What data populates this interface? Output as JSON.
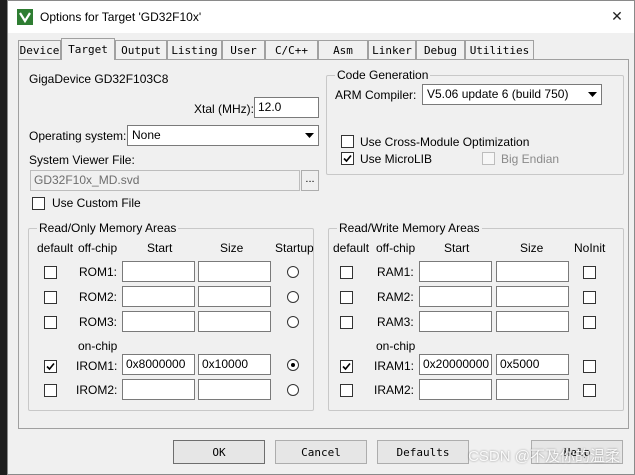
{
  "window": {
    "title": "Options for Target 'GD32F10x'",
    "close_glyph": "✕"
  },
  "tabs": [
    "Device",
    "Target",
    "Output",
    "Listing",
    "User",
    "C/C++",
    "Asm",
    "Linker",
    "Debug",
    "Utilities"
  ],
  "active_tab": "Target",
  "device": {
    "name": "GigaDevice GD32F103C8"
  },
  "xtal": {
    "label": "Xtal (MHz):",
    "value": "12.0"
  },
  "os": {
    "label": "Operating system:",
    "value": "None"
  },
  "sysviewer": {
    "label": "System Viewer File:",
    "value": "GD32F10x_MD.svd",
    "browse": "...",
    "custom_label": "Use Custom File",
    "custom_checked": false
  },
  "codegen": {
    "legend": "Code Generation",
    "compiler_label": "ARM Compiler:",
    "compiler_value": "V5.06 update 6 (build 750)",
    "cross_module_label": "Use Cross-Module Optimization",
    "cross_module_checked": false,
    "microlib_label": "Use MicroLIB",
    "microlib_checked": true,
    "big_endian_label": "Big Endian",
    "big_endian_checked": false
  },
  "rom": {
    "legend": "Read/Only Memory Areas",
    "headers": {
      "default": "default",
      "offchip": "off-chip",
      "start": "Start",
      "size": "Size",
      "startup": "Startup"
    },
    "onchip_label": "on-chip",
    "rows": [
      {
        "label": "ROM1:",
        "start": "",
        "size": "",
        "default": false,
        "startup": false
      },
      {
        "label": "ROM2:",
        "start": "",
        "size": "",
        "default": false,
        "startup": false
      },
      {
        "label": "ROM3:",
        "start": "",
        "size": "",
        "default": false,
        "startup": false
      },
      {
        "label": "IROM1:",
        "start": "0x8000000",
        "size": "0x10000",
        "default": true,
        "startup": true
      },
      {
        "label": "IROM2:",
        "start": "",
        "size": "",
        "default": false,
        "startup": false
      }
    ]
  },
  "ram": {
    "legend": "Read/Write Memory Areas",
    "headers": {
      "default": "default",
      "offchip": "off-chip",
      "start": "Start",
      "size": "Size",
      "noinit": "NoInit"
    },
    "onchip_label": "on-chip",
    "rows": [
      {
        "label": "RAM1:",
        "start": "",
        "size": "",
        "default": false,
        "noinit": false
      },
      {
        "label": "RAM2:",
        "start": "",
        "size": "",
        "default": false,
        "noinit": false
      },
      {
        "label": "RAM3:",
        "start": "",
        "size": "",
        "default": false,
        "noinit": false
      },
      {
        "label": "IRAM1:",
        "start": "0x20000000",
        "size": "0x5000",
        "default": true,
        "noinit": false
      },
      {
        "label": "IRAM2:",
        "start": "",
        "size": "",
        "default": false,
        "noinit": false
      }
    ]
  },
  "buttons": {
    "ok": "OK",
    "cancel": "Cancel",
    "defaults": "Defaults",
    "help": "Help"
  },
  "watermark": "CSDN @不及你的温柔"
}
